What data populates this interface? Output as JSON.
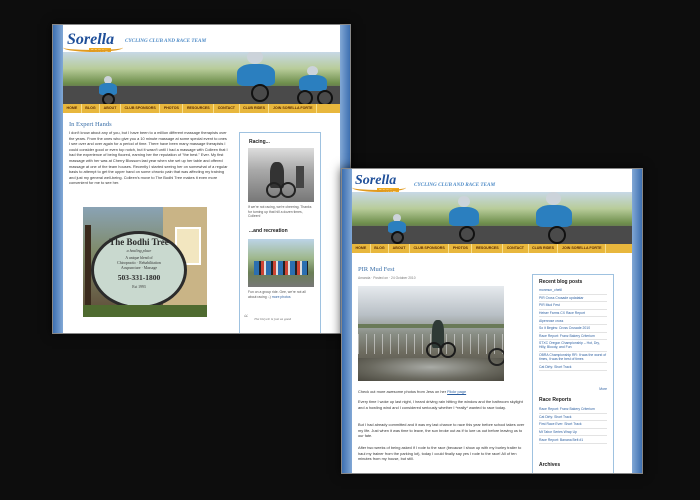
{
  "site": {
    "logo_main": "Sorella",
    "logo_sub": "FORTE",
    "tagline": "CYCLING CLUB AND RACE TEAM"
  },
  "nav": {
    "items": [
      "HOME",
      "BLOG",
      "ABOUT",
      "CLUB SPONSORS",
      "PHOTOS",
      "RESOURCES",
      "CONTACT",
      "CLUB RIDES",
      "JOIN SORELLA FORTE"
    ]
  },
  "page_a": {
    "title": "In Expert Hands",
    "body": "I don't know about any of you, but I have been to a million different massage therapists over the years. From the ones who give you a 10 minute massage at some special event to ones I see over and over again for a period of time. There have been many massage therapists I could consider good or even top notch, but it wasn't until I had a massage with Colleen that I had the experience of being floored, earning her the reputation of \"the best.\" Ever. My first massage with her was at Cherry Blossom last year when she set up her table and offered massage at one of the team houses. Recently I started seeing her on somewhat of a regular basis to attempt to get the upper hand on some chronic pain that was affecting my training and just my general well-being. Colleen's move to The Bodhi Tree makes it even more convenient for me to see her.",
    "sign": {
      "name": "The Bodhi Tree",
      "sub": "a healing place",
      "lines": [
        "A unique blend of",
        "Chiropractic · Rehabilitation",
        "Acupuncture · Massage"
      ],
      "phone": "503-331-1800",
      "est": "Est 1993"
    },
    "sidebar": {
      "racing_title": "Racing...",
      "racing_text": "If we're not racing, we're cheering. Thanks for turning up that hill a dozen times, Colleen!",
      "recreation_title": "...and recreation",
      "recreation_text": "Fun on a group ride. Gee, we're not all about racing :-) ",
      "recreation_link": "more photos",
      "quote": "The bicycle is just as good"
    }
  },
  "page_b": {
    "title": "PIR Mud Fest",
    "meta": "Amanda · Posted on · 24 October 2010",
    "para1_prefix": "Check out more awesome photos from Jess on her ",
    "para1_link": "Flickr page",
    "para2": "Every time I woke up last night, I heard driving rain hitting the window and the bathroom skylight and a howling wind and I considered seriously whether I *really* wanted to race today.",
    "para3": "But I had already committed and it was my last chance to race this year before school takes over my life. Just when it was time to leave, the sun broke out as if to lure us out before leaving us to our fate.",
    "para4": "After two weeks of being asked if I rode to the race (because I show up with my burley trailer to haul my trainer from the parking lot), today I could finally say yes I rode to the race! All of ten minutes from my house, but still.",
    "sidebar": {
      "recent_title": "Recent blog posts",
      "recent": [
        "monmun_chetil",
        "PIR Cross Crusade updatatar",
        "PIR Mud Fest",
        "Heiser Farms CX Race Report",
        "Alpenrose cross",
        "So it Begins: Cross Crusade 2010",
        "Race Report: Franz Bakery Criterium",
        "STXC Oregon Championship – Hot, Dry, Hilly, Bloody, and Fun",
        "OBRA Championship RR: It was the worst of times, it was the best of times",
        "Cat Dirty: Short Track"
      ],
      "more": "More",
      "reports_title": "Race Reports",
      "reports": [
        "Race Report: Franz Bakery Criterium",
        "Cat Dirty: Short Track",
        "First Race Ever: Short Track",
        "Mt Tabor Series Wrap Up",
        "Race Report: Banana Belt #1"
      ],
      "archives_title": "Archives"
    }
  }
}
